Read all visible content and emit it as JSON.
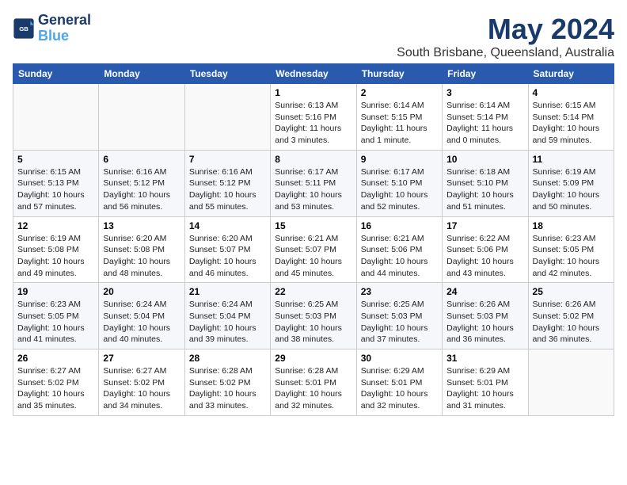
{
  "header": {
    "logo_line1": "General",
    "logo_line2": "Blue",
    "title": "May 2024",
    "subtitle": "South Brisbane, Queensland, Australia"
  },
  "days_of_week": [
    "Sunday",
    "Monday",
    "Tuesday",
    "Wednesday",
    "Thursday",
    "Friday",
    "Saturday"
  ],
  "weeks": [
    [
      {
        "num": "",
        "info": ""
      },
      {
        "num": "",
        "info": ""
      },
      {
        "num": "",
        "info": ""
      },
      {
        "num": "1",
        "info": "Sunrise: 6:13 AM\nSunset: 5:16 PM\nDaylight: 11 hours and 3 minutes."
      },
      {
        "num": "2",
        "info": "Sunrise: 6:14 AM\nSunset: 5:15 PM\nDaylight: 11 hours and 1 minute."
      },
      {
        "num": "3",
        "info": "Sunrise: 6:14 AM\nSunset: 5:14 PM\nDaylight: 11 hours and 0 minutes."
      },
      {
        "num": "4",
        "info": "Sunrise: 6:15 AM\nSunset: 5:14 PM\nDaylight: 10 hours and 59 minutes."
      }
    ],
    [
      {
        "num": "5",
        "info": "Sunrise: 6:15 AM\nSunset: 5:13 PM\nDaylight: 10 hours and 57 minutes."
      },
      {
        "num": "6",
        "info": "Sunrise: 6:16 AM\nSunset: 5:12 PM\nDaylight: 10 hours and 56 minutes."
      },
      {
        "num": "7",
        "info": "Sunrise: 6:16 AM\nSunset: 5:12 PM\nDaylight: 10 hours and 55 minutes."
      },
      {
        "num": "8",
        "info": "Sunrise: 6:17 AM\nSunset: 5:11 PM\nDaylight: 10 hours and 53 minutes."
      },
      {
        "num": "9",
        "info": "Sunrise: 6:17 AM\nSunset: 5:10 PM\nDaylight: 10 hours and 52 minutes."
      },
      {
        "num": "10",
        "info": "Sunrise: 6:18 AM\nSunset: 5:10 PM\nDaylight: 10 hours and 51 minutes."
      },
      {
        "num": "11",
        "info": "Sunrise: 6:19 AM\nSunset: 5:09 PM\nDaylight: 10 hours and 50 minutes."
      }
    ],
    [
      {
        "num": "12",
        "info": "Sunrise: 6:19 AM\nSunset: 5:08 PM\nDaylight: 10 hours and 49 minutes."
      },
      {
        "num": "13",
        "info": "Sunrise: 6:20 AM\nSunset: 5:08 PM\nDaylight: 10 hours and 48 minutes."
      },
      {
        "num": "14",
        "info": "Sunrise: 6:20 AM\nSunset: 5:07 PM\nDaylight: 10 hours and 46 minutes."
      },
      {
        "num": "15",
        "info": "Sunrise: 6:21 AM\nSunset: 5:07 PM\nDaylight: 10 hours and 45 minutes."
      },
      {
        "num": "16",
        "info": "Sunrise: 6:21 AM\nSunset: 5:06 PM\nDaylight: 10 hours and 44 minutes."
      },
      {
        "num": "17",
        "info": "Sunrise: 6:22 AM\nSunset: 5:06 PM\nDaylight: 10 hours and 43 minutes."
      },
      {
        "num": "18",
        "info": "Sunrise: 6:23 AM\nSunset: 5:05 PM\nDaylight: 10 hours and 42 minutes."
      }
    ],
    [
      {
        "num": "19",
        "info": "Sunrise: 6:23 AM\nSunset: 5:05 PM\nDaylight: 10 hours and 41 minutes."
      },
      {
        "num": "20",
        "info": "Sunrise: 6:24 AM\nSunset: 5:04 PM\nDaylight: 10 hours and 40 minutes."
      },
      {
        "num": "21",
        "info": "Sunrise: 6:24 AM\nSunset: 5:04 PM\nDaylight: 10 hours and 39 minutes."
      },
      {
        "num": "22",
        "info": "Sunrise: 6:25 AM\nSunset: 5:03 PM\nDaylight: 10 hours and 38 minutes."
      },
      {
        "num": "23",
        "info": "Sunrise: 6:25 AM\nSunset: 5:03 PM\nDaylight: 10 hours and 37 minutes."
      },
      {
        "num": "24",
        "info": "Sunrise: 6:26 AM\nSunset: 5:03 PM\nDaylight: 10 hours and 36 minutes."
      },
      {
        "num": "25",
        "info": "Sunrise: 6:26 AM\nSunset: 5:02 PM\nDaylight: 10 hours and 36 minutes."
      }
    ],
    [
      {
        "num": "26",
        "info": "Sunrise: 6:27 AM\nSunset: 5:02 PM\nDaylight: 10 hours and 35 minutes."
      },
      {
        "num": "27",
        "info": "Sunrise: 6:27 AM\nSunset: 5:02 PM\nDaylight: 10 hours and 34 minutes."
      },
      {
        "num": "28",
        "info": "Sunrise: 6:28 AM\nSunset: 5:02 PM\nDaylight: 10 hours and 33 minutes."
      },
      {
        "num": "29",
        "info": "Sunrise: 6:28 AM\nSunset: 5:01 PM\nDaylight: 10 hours and 32 minutes."
      },
      {
        "num": "30",
        "info": "Sunrise: 6:29 AM\nSunset: 5:01 PM\nDaylight: 10 hours and 32 minutes."
      },
      {
        "num": "31",
        "info": "Sunrise: 6:29 AM\nSunset: 5:01 PM\nDaylight: 10 hours and 31 minutes."
      },
      {
        "num": "",
        "info": ""
      }
    ]
  ]
}
